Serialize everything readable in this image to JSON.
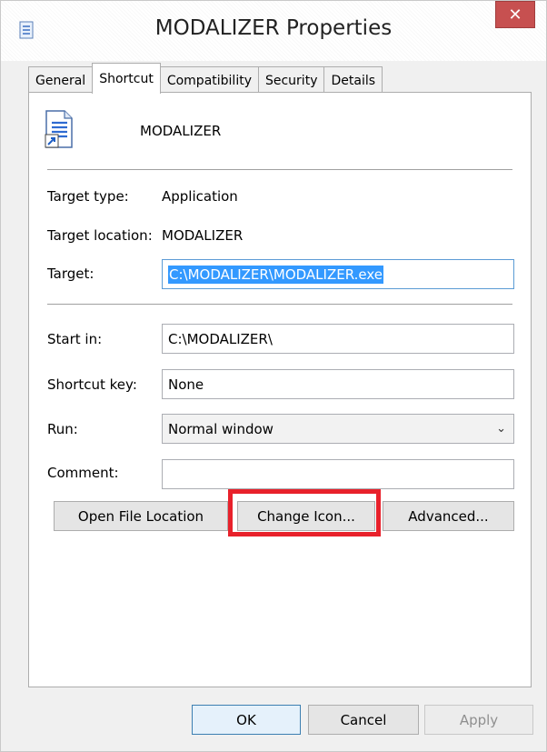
{
  "window": {
    "title": "MODALIZER Properties",
    "close_symbol": "✕"
  },
  "tabs": [
    {
      "label": "General",
      "active": false
    },
    {
      "label": "Shortcut",
      "active": true
    },
    {
      "label": "Compatibility",
      "active": false
    },
    {
      "label": "Security",
      "active": false
    },
    {
      "label": "Details",
      "active": false
    }
  ],
  "shortcut": {
    "name": "MODALIZER",
    "target_type_label": "Target type:",
    "target_type_value": "Application",
    "target_location_label": "Target location:",
    "target_location_value": "MODALIZER",
    "target_label": "Target:",
    "target_value": "C:\\MODALIZER\\MODALIZER.exe",
    "start_in_label": "Start in:",
    "start_in_value": "C:\\MODALIZER\\",
    "shortcut_key_label": "Shortcut key:",
    "shortcut_key_value": "None",
    "run_label": "Run:",
    "run_value": "Normal window",
    "comment_label": "Comment:",
    "comment_value": ""
  },
  "buttons": {
    "open_file_location": "Open File Location",
    "change_icon": "Change Icon...",
    "advanced": "Advanced...",
    "ok": "OK",
    "cancel": "Cancel",
    "apply": "Apply"
  },
  "colors": {
    "highlight": "#e8212b",
    "selection": "#3399ff",
    "close": "#c75050"
  }
}
